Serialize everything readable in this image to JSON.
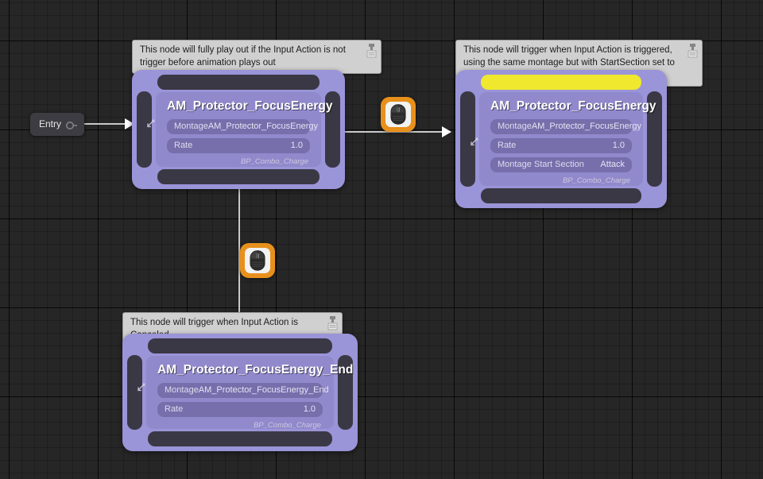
{
  "graph": {
    "entry": {
      "label": "Entry",
      "icon": "entry-pin-icon"
    },
    "comments": [
      {
        "id": "comment-state-1",
        "text": "This node will fully play out if the Input Action is not trigger before animation plays out"
      },
      {
        "id": "comment-state-2",
        "text": "This node will trigger when Input Action is triggered, using the same montage but with StartSection set to \"Attack\""
      },
      {
        "id": "comment-state-3",
        "text": "This node will trigger when Input Action is Canceled"
      }
    ],
    "states": [
      {
        "id": "state-focus-energy",
        "title": "AM_Protector_FocusEnergy",
        "highlighted": false,
        "properties": [
          {
            "label": "Montage",
            "value": "AM_Protector_FocusEnergy"
          },
          {
            "label": "Rate",
            "value": "1.0"
          }
        ],
        "footer": "BP_Combo_Charge"
      },
      {
        "id": "state-focus-energy-attack",
        "title": "AM_Protector_FocusEnergy",
        "highlighted": true,
        "properties": [
          {
            "label": "Montage",
            "value": "AM_Protector_FocusEnergy"
          },
          {
            "label": "Rate",
            "value": "1.0"
          },
          {
            "label": "Montage Start Section",
            "value": "Attack"
          }
        ],
        "footer": "BP_Combo_Charge"
      },
      {
        "id": "state-focus-energy-end",
        "title": "AM_Protector_FocusEnergy_End",
        "highlighted": false,
        "properties": [
          {
            "label": "Montage",
            "value": "AM_Protector_FocusEnergy_End"
          },
          {
            "label": "Rate",
            "value": "1.0"
          }
        ],
        "footer": "BP_Combo_Charge"
      }
    ],
    "transitions": [
      {
        "id": "transition-right",
        "icon": "mouse-icon"
      },
      {
        "id": "transition-down",
        "icon": "mouse-icon"
      }
    ],
    "colors": {
      "canvas": "#262626",
      "node_frame": "#9a94d8",
      "node_body": "#8a83c5",
      "node_bar": "#3a3844",
      "highlight_bar": "#efe82e",
      "transition_badge": "#e8901c",
      "comment_bg": "#d0d0d0",
      "wire": "#c9c9c9"
    }
  }
}
